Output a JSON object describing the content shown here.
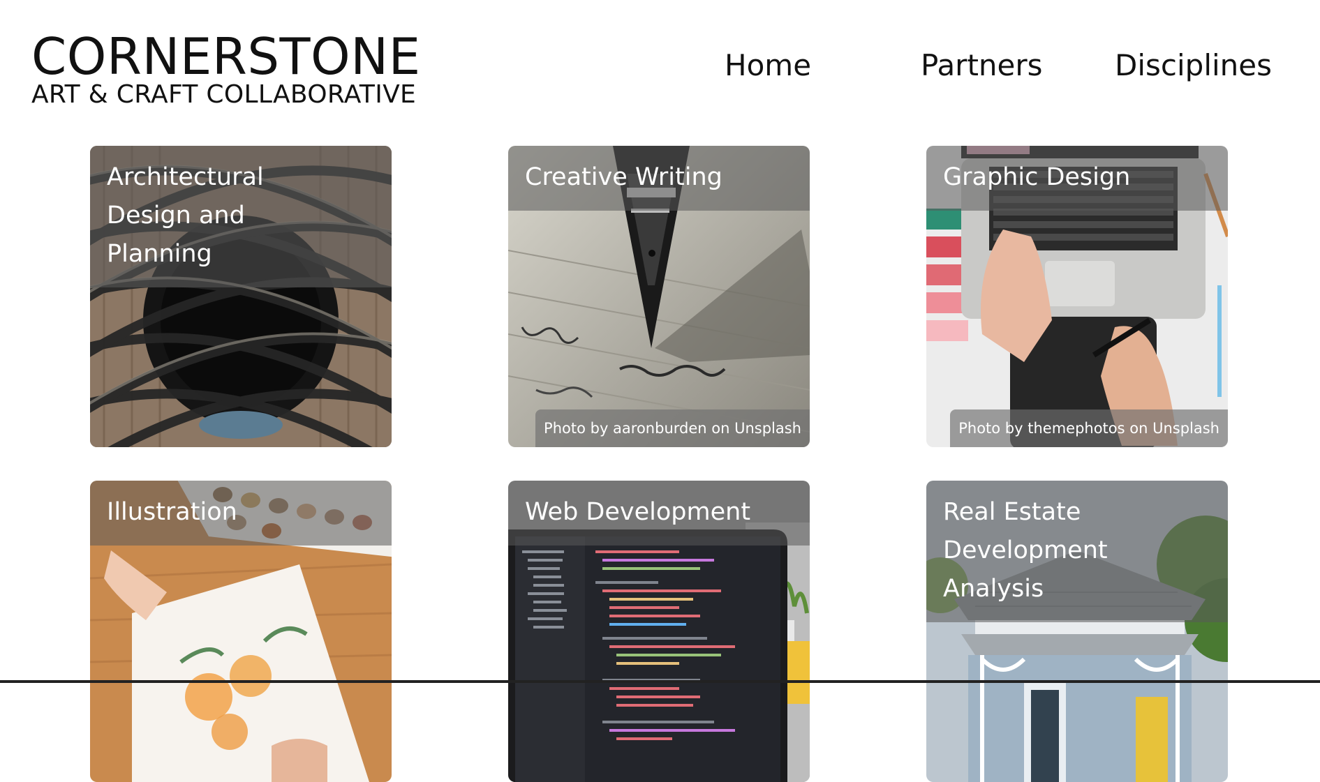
{
  "brand": {
    "name": "CORNERSTONE",
    "tagline": "ART & CRAFT COLLABORATIVE"
  },
  "nav": [
    {
      "label": "Home"
    },
    {
      "label": "Partners"
    },
    {
      "label": "Disciplines"
    }
  ],
  "cards": [
    {
      "title": "Architectural Design and Planning",
      "credit": "",
      "image": "architecture-photo"
    },
    {
      "title": "Creative Writing",
      "credit": "Photo by aaronburden on Unsplash",
      "image": "fountain-pen-photo"
    },
    {
      "title": "Graphic Design",
      "credit": "Photo by themephotos on Unsplash",
      "image": "laptop-tablet-photo"
    },
    {
      "title": "Illustration",
      "credit": "",
      "image": "watercolor-photo"
    },
    {
      "title": "Web Development",
      "credit": "",
      "image": "code-laptop-photo"
    },
    {
      "title": "Real Estate Development Analysis",
      "credit": "",
      "image": "house-photo"
    }
  ]
}
